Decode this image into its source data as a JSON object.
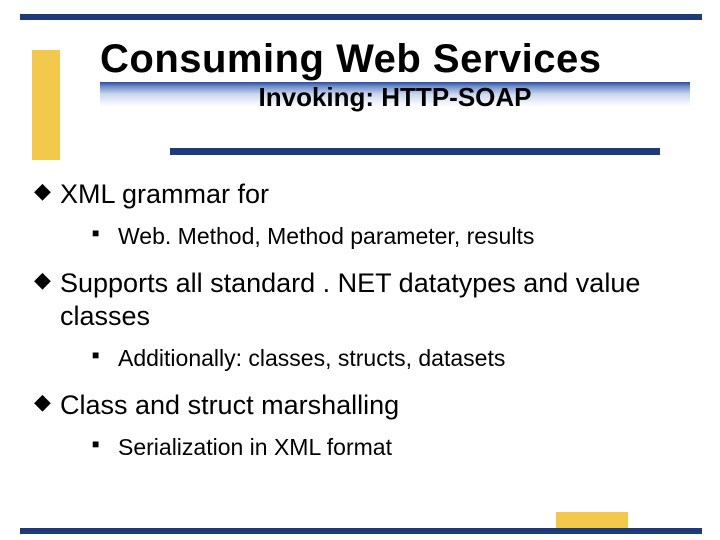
{
  "title": "Consuming Web Services",
  "subtitle": "Invoking: HTTP-SOAP",
  "bullets": [
    {
      "text": "XML grammar for",
      "sub": [
        {
          "text": "Web. Method, Method parameter, results"
        }
      ]
    },
    {
      "text": "Supports all standard . NET datatypes and value classes",
      "sub": [
        {
          "text": "Additionally: classes, structs, datasets"
        }
      ]
    },
    {
      "text": "Class and struct marshalling",
      "sub": [
        {
          "text": "Serialization in XML format"
        }
      ]
    }
  ],
  "glyphs": {
    "l1": "◆",
    "l2": "■"
  }
}
